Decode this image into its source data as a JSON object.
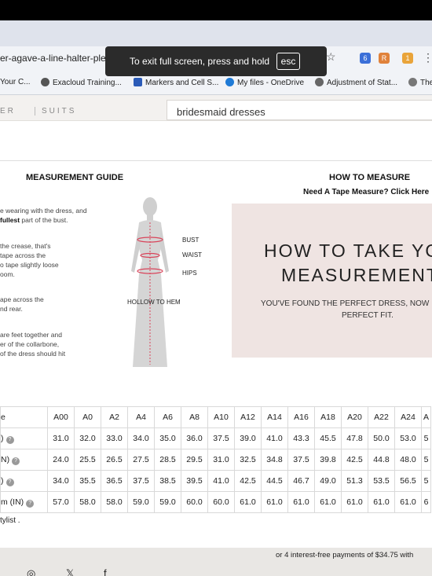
{
  "browser": {
    "url": "er-agave-a-line-halter-ple",
    "bookmarks": [
      "Your C...",
      "Exacloud Training...",
      "Markers and Cell S...",
      "My files - OneDrive",
      "Adjustment of Stat...",
      "The"
    ],
    "ext_badges": [
      "6",
      "1"
    ],
    "fullscreen_toast": "To exit full screen, press and hold",
    "fullscreen_key": "esc"
  },
  "site": {
    "brand_left": "ER",
    "brand_right": "SUITS",
    "search_value": "bridesmaid dresses"
  },
  "guide": {
    "title": "MEASUREMENT GUIDE",
    "p1_a": "e wearing with the dress, and",
    "p1_b": "fullest",
    "p1_c": " part of the bust.",
    "p2_a": " the crease, that's",
    "p2_b": "tape across the",
    "p2_c": "o tape slightly loose",
    "p2_d": "oom.",
    "p3_a": "ape across the",
    "p3_b": "nd rear.",
    "p4_a": "are feet together and",
    "p4_b": "er of the collarbone,",
    "p4_c": " of the dress should hit",
    "labels": {
      "bust": "BUST",
      "waist": "WAIST",
      "hips": "HIPS",
      "hollow": "HOLLOW TO HEM"
    }
  },
  "howto": {
    "title": "HOW TO MEASURE",
    "subtitle": "Need A Tape Measure? Click Here",
    "video_line1": "HOW TO TAKE YO",
    "video_line2": "MEASUREMENT",
    "video_line3": "YOU'VE FOUND THE PERFECT DRESS, NOW",
    "video_line4": "PERFECT FIT."
  },
  "size_table": {
    "header_label": "e",
    "sizes": [
      "A00",
      "A0",
      "A2",
      "A4",
      "A6",
      "A8",
      "A10",
      "A12",
      "A14",
      "A16",
      "A18",
      "A20",
      "A22",
      "A24",
      "A"
    ],
    "rows": [
      {
        "label": ")",
        "values": [
          "31.0",
          "32.0",
          "33.0",
          "34.0",
          "35.0",
          "36.0",
          "37.5",
          "39.0",
          "41.0",
          "43.3",
          "45.5",
          "47.8",
          "50.0",
          "53.0",
          "5"
        ]
      },
      {
        "label": "N)",
        "values": [
          "24.0",
          "25.5",
          "26.5",
          "27.5",
          "28.5",
          "29.5",
          "31.0",
          "32.5",
          "34.8",
          "37.5",
          "39.8",
          "42.5",
          "44.8",
          "48.0",
          "5"
        ]
      },
      {
        "label": ")",
        "values": [
          "34.0",
          "35.5",
          "36.5",
          "37.5",
          "38.5",
          "39.5",
          "41.0",
          "42.5",
          "44.5",
          "46.7",
          "49.0",
          "51.3",
          "53.5",
          "56.5",
          "5"
        ]
      },
      {
        "label": "m (IN)",
        "values": [
          "57.0",
          "58.0",
          "58.0",
          "59.0",
          "59.0",
          "60.0",
          "60.0",
          "61.0",
          "61.0",
          "61.0",
          "61.0",
          "61.0",
          "61.0",
          "61.0",
          "6"
        ]
      }
    ],
    "note": "tylist ."
  },
  "footer": {
    "pay_note": "or 4 interest-free payments of $34.75 with"
  }
}
